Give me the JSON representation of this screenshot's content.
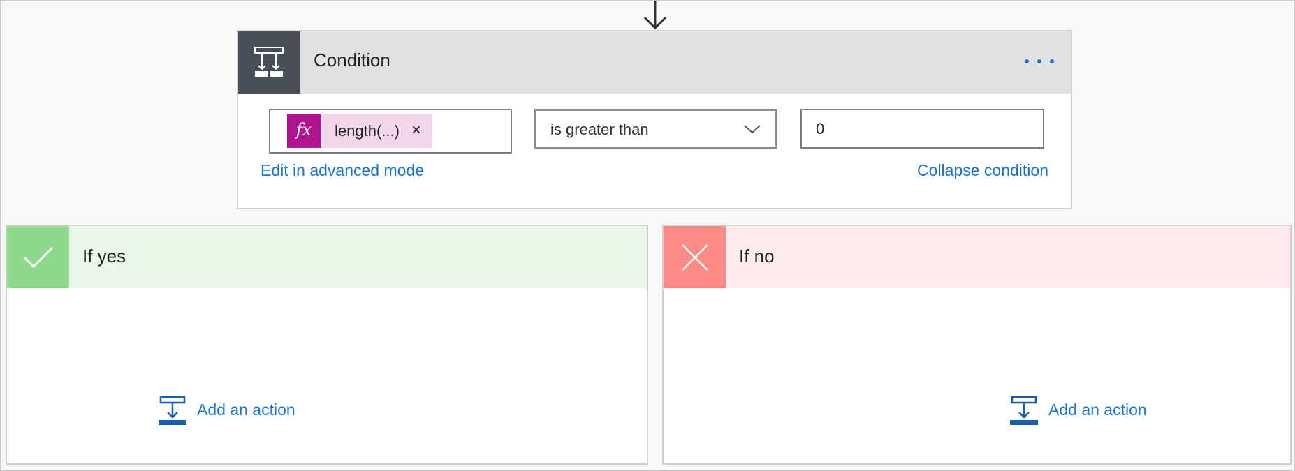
{
  "condition": {
    "title": "Condition",
    "icon": "condition-icon",
    "more_icon": "more-options-icon",
    "operand": {
      "fx_label": "fx",
      "token_label": "length(...)",
      "remove_glyph": "×"
    },
    "operator": {
      "selected": "is greater than",
      "icon": "chevron-down-icon"
    },
    "value": "0",
    "edit_advanced_label": "Edit in advanced mode",
    "collapse_label": "Collapse condition"
  },
  "branches": {
    "yes": {
      "title": "If yes",
      "icon": "check-icon",
      "add_action_label": "Add an action",
      "color": "#8dd98e"
    },
    "no": {
      "title": "If no",
      "icon": "close-icon",
      "add_action_label": "Add an action",
      "color": "#fd8a84"
    }
  },
  "colors": {
    "link": "#1a73cc",
    "condition_icon_bg": "#484f58",
    "fx_bg": "#b0138e",
    "token_bg": "#f2d6ec"
  }
}
